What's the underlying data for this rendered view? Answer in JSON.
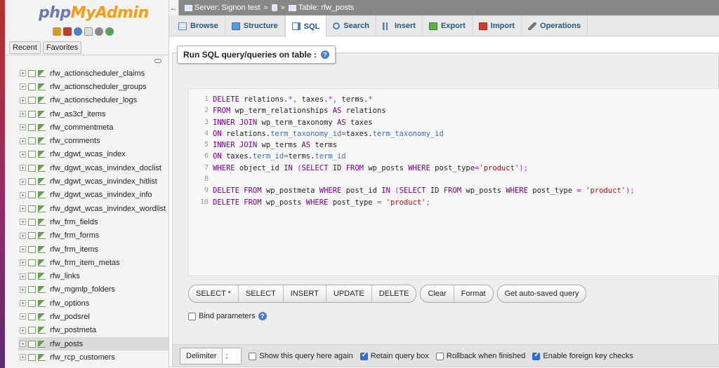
{
  "sidebar": {
    "logo_php": "php",
    "logo_myadmin": "MyAdmin",
    "tabs": [
      "Recent",
      "Favorites"
    ],
    "tables": [
      "rfw_actionscheduler_claims",
      "rfw_actionscheduler_groups",
      "rfw_actionscheduler_logs",
      "rfw_as3cf_items",
      "rfw_commentmeta",
      "rfw_comments",
      "rfw_dgwt_wcas_index",
      "rfw_dgwt_wcas_invindex_doclist",
      "rfw_dgwt_wcas_invindex_hitlist",
      "rfw_dgwt_wcas_invindex_info",
      "rfw_dgwt_wcas_invindex_wordlist",
      "rfw_frm_fields",
      "rfw_frm_forms",
      "rfw_frm_items",
      "rfw_frm_item_metas",
      "rfw_links",
      "rfw_mgmlp_folders",
      "rfw_options",
      "rfw_podsrel",
      "rfw_postmeta",
      "rfw_posts",
      "rfw_rcp_customers"
    ],
    "selected": "rfw_posts"
  },
  "breadcrumb": {
    "server": "Server: Signon test",
    "separator": "»",
    "table": "Table: rfw_posts"
  },
  "tabs": [
    {
      "label": "Browse",
      "icon": "browse-icon"
    },
    {
      "label": "Structure",
      "icon": "structure-icon"
    },
    {
      "label": "SQL",
      "icon": "sql-icon",
      "active": true
    },
    {
      "label": "Search",
      "icon": "search-icon"
    },
    {
      "label": "Insert",
      "icon": "insert-icon"
    },
    {
      "label": "Export",
      "icon": "export-icon"
    },
    {
      "label": "Import",
      "icon": "import-icon"
    },
    {
      "label": "Operations",
      "icon": "operations-icon"
    }
  ],
  "sql_panel": {
    "legend": "Run SQL query/queries on table :",
    "lines": [
      "DELETE relations.*, taxes.*, terms.*",
      "FROM wp_term_relationships AS relations",
      "INNER JOIN wp_term_taxonomy AS taxes",
      "ON relations.term_taxonomy_id=taxes.term_taxonomy_id",
      "INNER JOIN wp_terms AS terms",
      "ON taxes.term_id=terms.term_id",
      "WHERE object_id IN (SELECT ID FROM wp_posts WHERE post_type='product');",
      "",
      "DELETE FROM wp_postmeta WHERE post_id IN (SELECT ID FROM wp_posts WHERE post_type = 'product');",
      "DELETE FROM wp_posts WHERE post_type = 'product';"
    ],
    "buttons_group1": [
      "SELECT *",
      "SELECT",
      "INSERT",
      "UPDATE",
      "DELETE"
    ],
    "buttons_group2": [
      "Clear",
      "Format"
    ],
    "button_autosaved": "Get auto-saved query",
    "bind_parameters": "Bind parameters",
    "delimiter_label": "Delimiter",
    "delimiter_value": ";",
    "options": [
      {
        "label": "Show this query here again",
        "checked": false
      },
      {
        "label": "Retain query box",
        "checked": true
      },
      {
        "label": "Rollback when finished",
        "checked": false
      },
      {
        "label": "Enable foreign key checks",
        "checked": true
      }
    ]
  }
}
